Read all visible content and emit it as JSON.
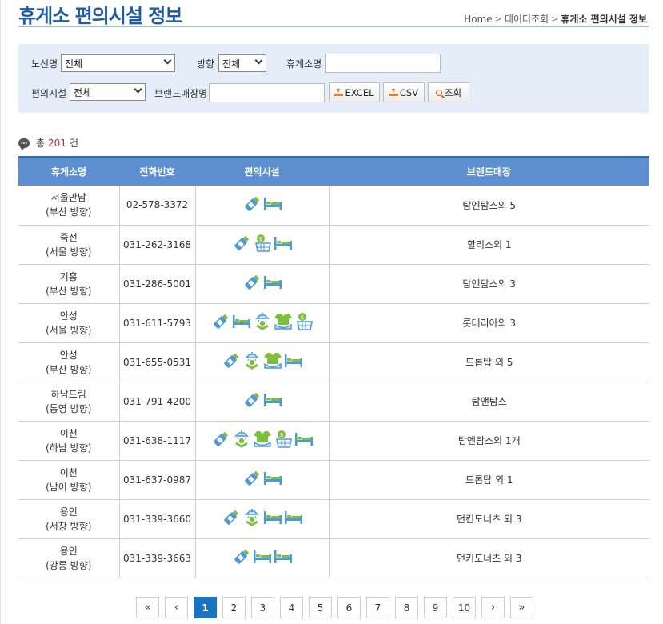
{
  "page": {
    "title": "휴게소 편의시설 정보"
  },
  "breadcrumb": [
    "Home",
    "데이터조회",
    "휴게소 편의시설 정보"
  ],
  "search": {
    "route_label": "노선명",
    "route_value": "전체",
    "direction_label": "방향",
    "direction_value": "전체",
    "rest_area_label": "휴게소명",
    "rest_area_value": "",
    "facility_label": "편의시설",
    "facility_value": "전체",
    "brand_label": "브랜드매장명",
    "brand_value": "",
    "excel_label": "EXCEL",
    "csv_label": "CSV",
    "search_label": "조회"
  },
  "count": {
    "prefix": "총",
    "value": "201",
    "suffix": "건"
  },
  "table": {
    "headers": [
      "휴게소명",
      "전화번호",
      "편의시설",
      "브랜드매장"
    ],
    "rows": [
      {
        "name": "서울만남",
        "direction": "(부산 방향)",
        "phone": "02-578-3372",
        "facilities": [
          "pharmacy-icon",
          "sleeping-room-icon"
        ],
        "brand": "탐엔탐스외 5"
      },
      {
        "name": "죽전",
        "direction": "(서울 방향)",
        "phone": "031-262-3168",
        "facilities": [
          "pharmacy-icon",
          "shopping-basket-icon",
          "sleeping-room-icon"
        ],
        "brand": "할리스외 1"
      },
      {
        "name": "기흥",
        "direction": "(부산 방향)",
        "phone": "031-286-5001",
        "facilities": [
          "pharmacy-icon",
          "sleeping-room-icon"
        ],
        "brand": "탐엔탐스외 3"
      },
      {
        "name": "안성",
        "direction": "(서울 방향)",
        "phone": "031-611-5793",
        "facilities": [
          "pharmacy-icon",
          "sleeping-room-icon",
          "shower-icon",
          "laundry-icon",
          "shopping-basket-icon"
        ],
        "brand": "롯데리아외 3"
      },
      {
        "name": "안성",
        "direction": "(부산 방향)",
        "phone": "031-655-0531",
        "facilities": [
          "pharmacy-icon",
          "shower-icon",
          "laundry-icon",
          "sleeping-room-icon"
        ],
        "brand": "드롭탑 외 5"
      },
      {
        "name": "하남드림",
        "direction": "(통영 방향)",
        "phone": "031-791-4200",
        "facilities": [
          "pharmacy-icon",
          "sleeping-room-icon"
        ],
        "brand": "탐앤탐스"
      },
      {
        "name": "이천",
        "direction": "(하남 방향)",
        "phone": "031-638-1117",
        "facilities": [
          "pharmacy-icon",
          "shower-icon",
          "laundry-icon",
          "shopping-basket-icon",
          "sleeping-room-icon"
        ],
        "brand": "탐엔탐스외 1개"
      },
      {
        "name": "이천",
        "direction": "(남이 방향)",
        "phone": "031-637-0987",
        "facilities": [
          "pharmacy-icon",
          "sleeping-room-icon"
        ],
        "brand": "드롭탑 외 1"
      },
      {
        "name": "용인",
        "direction": "(서창 방향)",
        "phone": "031-339-3660",
        "facilities": [
          "pharmacy-icon",
          "shower-icon",
          "sleeping-room-icon",
          "sleeping-room-icon"
        ],
        "brand": "던킨도너츠 외 3"
      },
      {
        "name": "용인",
        "direction": "(강릉 방향)",
        "phone": "031-339-3663",
        "facilities": [
          "pharmacy-icon",
          "sleeping-room-icon",
          "sleeping-room-icon"
        ],
        "brand": "던키도너츠 외 3"
      }
    ]
  },
  "pagination": {
    "first": "«",
    "prev": "‹",
    "next": "›",
    "last": "»",
    "pages": [
      "1",
      "2",
      "3",
      "4",
      "5",
      "6",
      "7",
      "8",
      "9",
      "10"
    ],
    "current": "1"
  }
}
